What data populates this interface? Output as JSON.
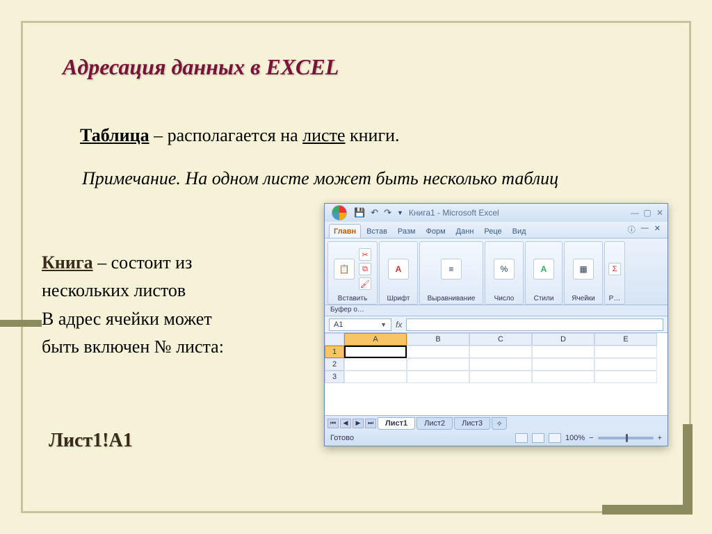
{
  "slide": {
    "title": "Адресация данных в EXCEL",
    "line1_bold": "Таблица",
    "line1_mid": " – располагается на ",
    "line1_u": "листе",
    "line1_end": " книги.",
    "note_label": "Примечание.",
    "note_text": " На одном листе может быть несколько таблиц",
    "body_bold": "Книга",
    "body1": " – состоит из",
    "body2": "нескольких листов",
    "body3": "В адрес ячейки может",
    "body4": "быть включен № листа:",
    "example": "Лист1!А1"
  },
  "excel": {
    "window_title": "Книга1 - Microsoft Excel",
    "qat_icons": [
      "💾",
      "↶",
      "↷"
    ],
    "tabs": [
      "Главн",
      "Встав",
      "Разм",
      "Форм",
      "Данн",
      "Реце",
      "Вид"
    ],
    "active_tab": 0,
    "ribbon": {
      "paste": "Вставить",
      "clipboard": "Буфер о…",
      "font": "Шрифт",
      "align": "Выравнивание",
      "number": "Число",
      "styles": "Стили",
      "cells": "Ячейки"
    },
    "namebox": "A1",
    "fx": "fx",
    "columns": [
      "A",
      "B",
      "C",
      "D",
      "E"
    ],
    "rows": [
      "1",
      "2",
      "3"
    ],
    "sheets": [
      "Лист1",
      "Лист2",
      "Лист3"
    ],
    "active_sheet": 0,
    "status": "Готово",
    "zoom": "100%"
  }
}
